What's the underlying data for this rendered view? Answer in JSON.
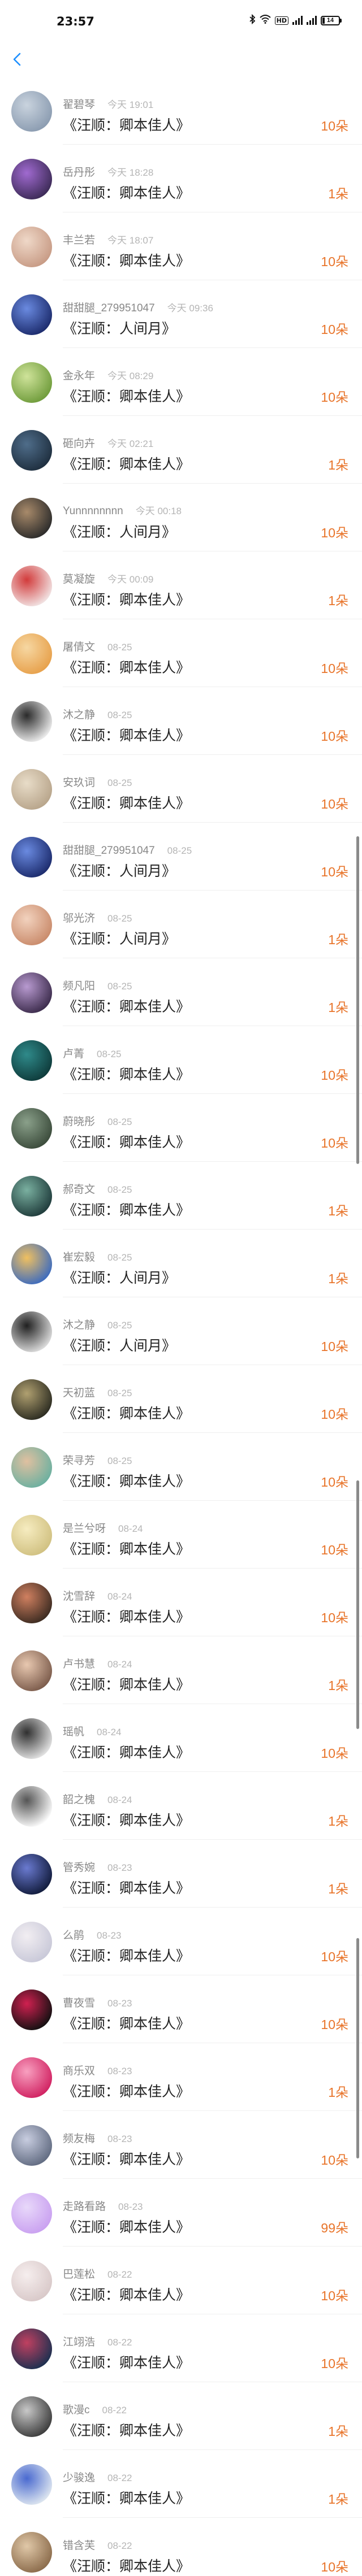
{
  "status_bar": {
    "time": "23:57",
    "icons": [
      "bluetooth-icon",
      "wifi-icon",
      "hd-icon",
      "signal-icon",
      "signal-icon",
      "battery-icon"
    ],
    "hd_label": "HD",
    "battery_level": "14"
  },
  "nav": {
    "back_icon": "chevron-left-icon",
    "accent": "#1e90ff"
  },
  "colors": {
    "reward": "#e8742a",
    "name": "#888888",
    "time": "#b5b5b5"
  },
  "items": [
    {
      "name": "翟碧琴",
      "time": "今天 19:01",
      "title": "《汪顺：卿本佳人》",
      "reward": "10朵"
    },
    {
      "name": "岳丹彤",
      "time": "今天 18:28",
      "title": "《汪顺：卿本佳人》",
      "reward": "1朵"
    },
    {
      "name": "丰兰若",
      "time": "今天 18:07",
      "title": "《汪顺：卿本佳人》",
      "reward": "10朵"
    },
    {
      "name": "甜甜腿_279951047",
      "time": "今天 09:36",
      "title": "《汪顺：人间月》",
      "reward": "10朵"
    },
    {
      "name": "金永年",
      "time": "今天 08:29",
      "title": "《汪顺：卿本佳人》",
      "reward": "10朵"
    },
    {
      "name": "砸向卉",
      "time": "今天 02:21",
      "title": "《汪顺：卿本佳人》",
      "reward": "1朵"
    },
    {
      "name": "Yunnnnnnnn",
      "time": "今天 00:18",
      "title": "《汪顺：人间月》",
      "reward": "10朵"
    },
    {
      "name": "莫凝旋",
      "time": "今天 00:09",
      "title": "《汪顺：卿本佳人》",
      "reward": "1朵"
    },
    {
      "name": "屠倩文",
      "time": "08-25",
      "title": "《汪顺：卿本佳人》",
      "reward": "10朵"
    },
    {
      "name": "沐之静",
      "time": "08-25",
      "title": "《汪顺：卿本佳人》",
      "reward": "10朵"
    },
    {
      "name": "安玖词",
      "time": "08-25",
      "title": "《汪顺：卿本佳人》",
      "reward": "10朵"
    },
    {
      "name": "甜甜腿_279951047",
      "time": "08-25",
      "title": "《汪顺：人间月》",
      "reward": "10朵"
    },
    {
      "name": "邬光济",
      "time": "08-25",
      "title": "《汪顺：人间月》",
      "reward": "1朵"
    },
    {
      "name": "频凡阳",
      "time": "08-25",
      "title": "《汪顺：卿本佳人》",
      "reward": "1朵"
    },
    {
      "name": "卢菁",
      "time": "08-25",
      "title": "《汪顺：卿本佳人》",
      "reward": "10朵"
    },
    {
      "name": "蔚晓彤",
      "time": "08-25",
      "title": "《汪顺：卿本佳人》",
      "reward": "10朵"
    },
    {
      "name": "郝奇文",
      "time": "08-25",
      "title": "《汪顺：卿本佳人》",
      "reward": "1朵"
    },
    {
      "name": "崔宏毅",
      "time": "08-25",
      "title": "《汪顺：人间月》",
      "reward": "1朵"
    },
    {
      "name": "沐之静",
      "time": "08-25",
      "title": "《汪顺：人间月》",
      "reward": "10朵"
    },
    {
      "name": "天初蓝",
      "time": "08-25",
      "title": "《汪顺：卿本佳人》",
      "reward": "10朵"
    },
    {
      "name": "荣寻芳",
      "time": "08-25",
      "title": "《汪顺：卿本佳人》",
      "reward": "10朵"
    },
    {
      "name": "是兰兮呀",
      "time": "08-24",
      "title": "《汪顺：卿本佳人》",
      "reward": "10朵"
    },
    {
      "name": "沈雪辞",
      "time": "08-24",
      "title": "《汪顺：卿本佳人》",
      "reward": "10朵"
    },
    {
      "name": "卢书慧",
      "time": "08-24",
      "title": "《汪顺：卿本佳人》",
      "reward": "1朵"
    },
    {
      "name": "瑶帆",
      "time": "08-24",
      "title": "《汪顺：卿本佳人》",
      "reward": "10朵"
    },
    {
      "name": "韶之槐",
      "time": "08-24",
      "title": "《汪顺：卿本佳人》",
      "reward": "1朵"
    },
    {
      "name": "管秀婉",
      "time": "08-23",
      "title": "《汪顺：卿本佳人》",
      "reward": "1朵"
    },
    {
      "name": "么鹃",
      "time": "08-23",
      "title": "《汪顺：卿本佳人》",
      "reward": "10朵"
    },
    {
      "name": "曹夜雪",
      "time": "08-23",
      "title": "《汪顺：卿本佳人》",
      "reward": "10朵"
    },
    {
      "name": "商乐双",
      "time": "08-23",
      "title": "《汪顺：卿本佳人》",
      "reward": "1朵"
    },
    {
      "name": "频友梅",
      "time": "08-23",
      "title": "《汪顺：卿本佳人》",
      "reward": "10朵"
    },
    {
      "name": "走路看路",
      "time": "08-23",
      "title": "《汪顺：卿本佳人》",
      "reward": "99朵"
    },
    {
      "name": "巴莲松",
      "time": "08-22",
      "title": "《汪顺：卿本佳人》",
      "reward": "10朵"
    },
    {
      "name": "江翊浩",
      "time": "08-22",
      "title": "《汪顺：卿本佳人》",
      "reward": "10朵"
    },
    {
      "name": "歌漫c",
      "time": "08-22",
      "title": "《汪顺：卿本佳人》",
      "reward": "1朵"
    },
    {
      "name": "少骏逸",
      "time": "08-22",
      "title": "《汪顺：卿本佳人》",
      "reward": "1朵"
    },
    {
      "name": "错含芙",
      "time": "08-22",
      "title": "《汪顺：卿本佳人》",
      "reward": "10朵"
    }
  ]
}
